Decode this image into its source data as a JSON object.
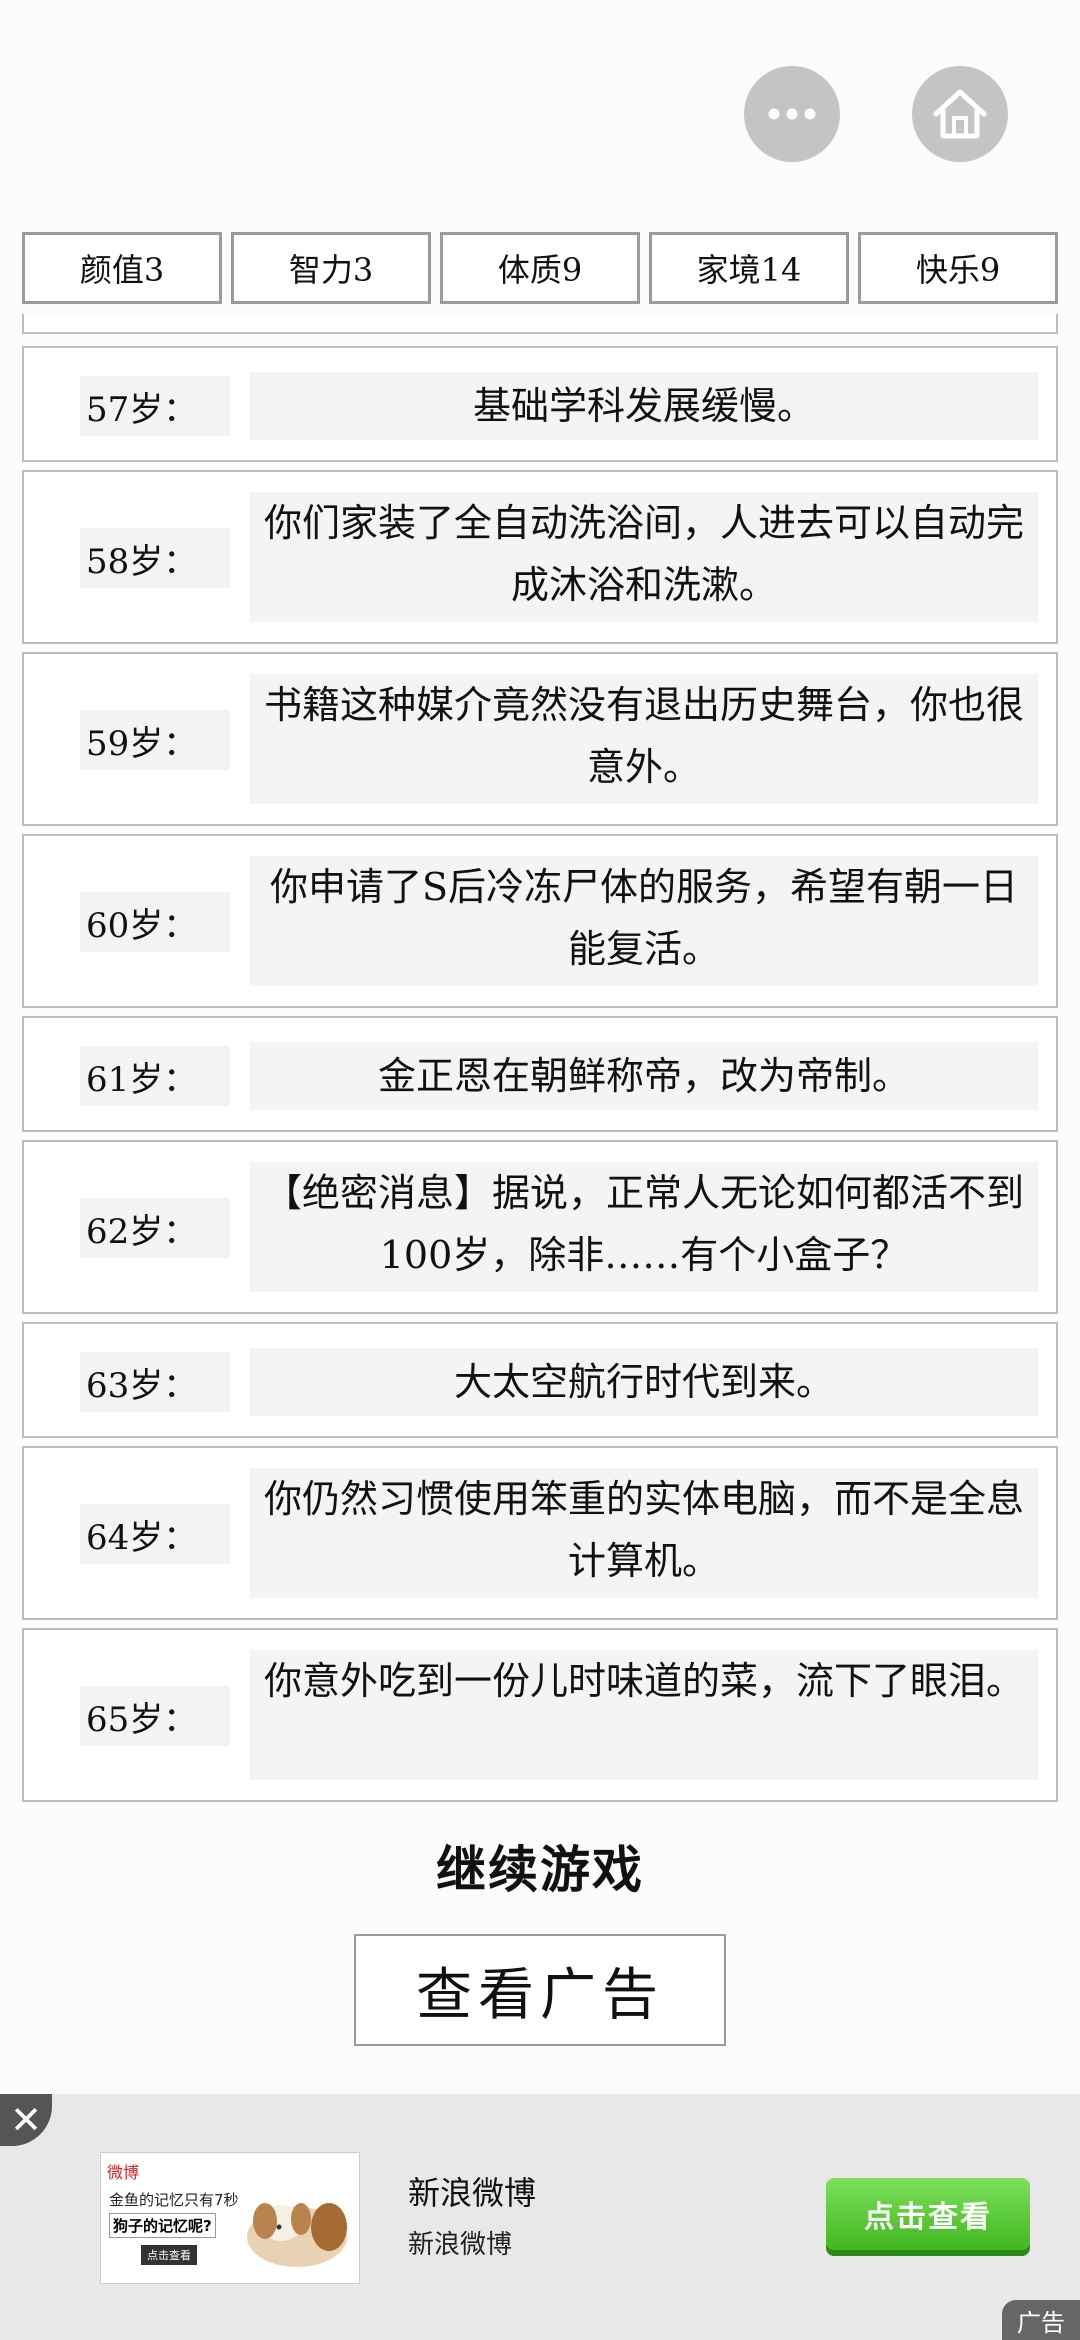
{
  "top_buttons": {
    "more_icon": "more-dots-icon",
    "home_icon": "home-icon"
  },
  "stats": [
    {
      "label": "颜值3"
    },
    {
      "label": "智力3"
    },
    {
      "label": "体质9"
    },
    {
      "label": "家境14"
    },
    {
      "label": "快乐9"
    }
  ],
  "events": [
    {
      "age": "57岁：",
      "text": "基础学科发展缓慢。"
    },
    {
      "age": "58岁：",
      "text": "你们家装了全自动洗浴间，人进去可以自动完成沐浴和洗漱。"
    },
    {
      "age": "59岁：",
      "text": "书籍这种媒介竟然没有退出历史舞台，你也很意外。"
    },
    {
      "age": "60岁：",
      "text": "你申请了S后冷冻尸体的服务，希望有朝一日能复活。"
    },
    {
      "age": "61岁：",
      "text": "金正恩在朝鲜称帝，改为帝制。"
    },
    {
      "age": "62岁：",
      "text": "【绝密消息】据说，正常人无论如何都活不到100岁，除非……有个小盒子？"
    },
    {
      "age": "63岁：",
      "text": "大太空航行时代到来。"
    },
    {
      "age": "64岁：",
      "text": "你仍然习惯使用笨重的实体电脑，而不是全息计算机。"
    },
    {
      "age": "65岁：",
      "text": "你意外吃到一份儿时味道的菜，流下了眼泪。"
    }
  ],
  "continue_label": "继续游戏",
  "watch_ad_label": "查看广告",
  "banner": {
    "img_brand": "微博",
    "img_line1": "金鱼的记忆只有7秒",
    "img_line2": "狗子的记忆呢?",
    "img_button": "点击查看",
    "title": "新浪微博",
    "subtitle": "新浪微博",
    "cta": "点击查看",
    "close": "✕",
    "ad_tag": "广告"
  }
}
